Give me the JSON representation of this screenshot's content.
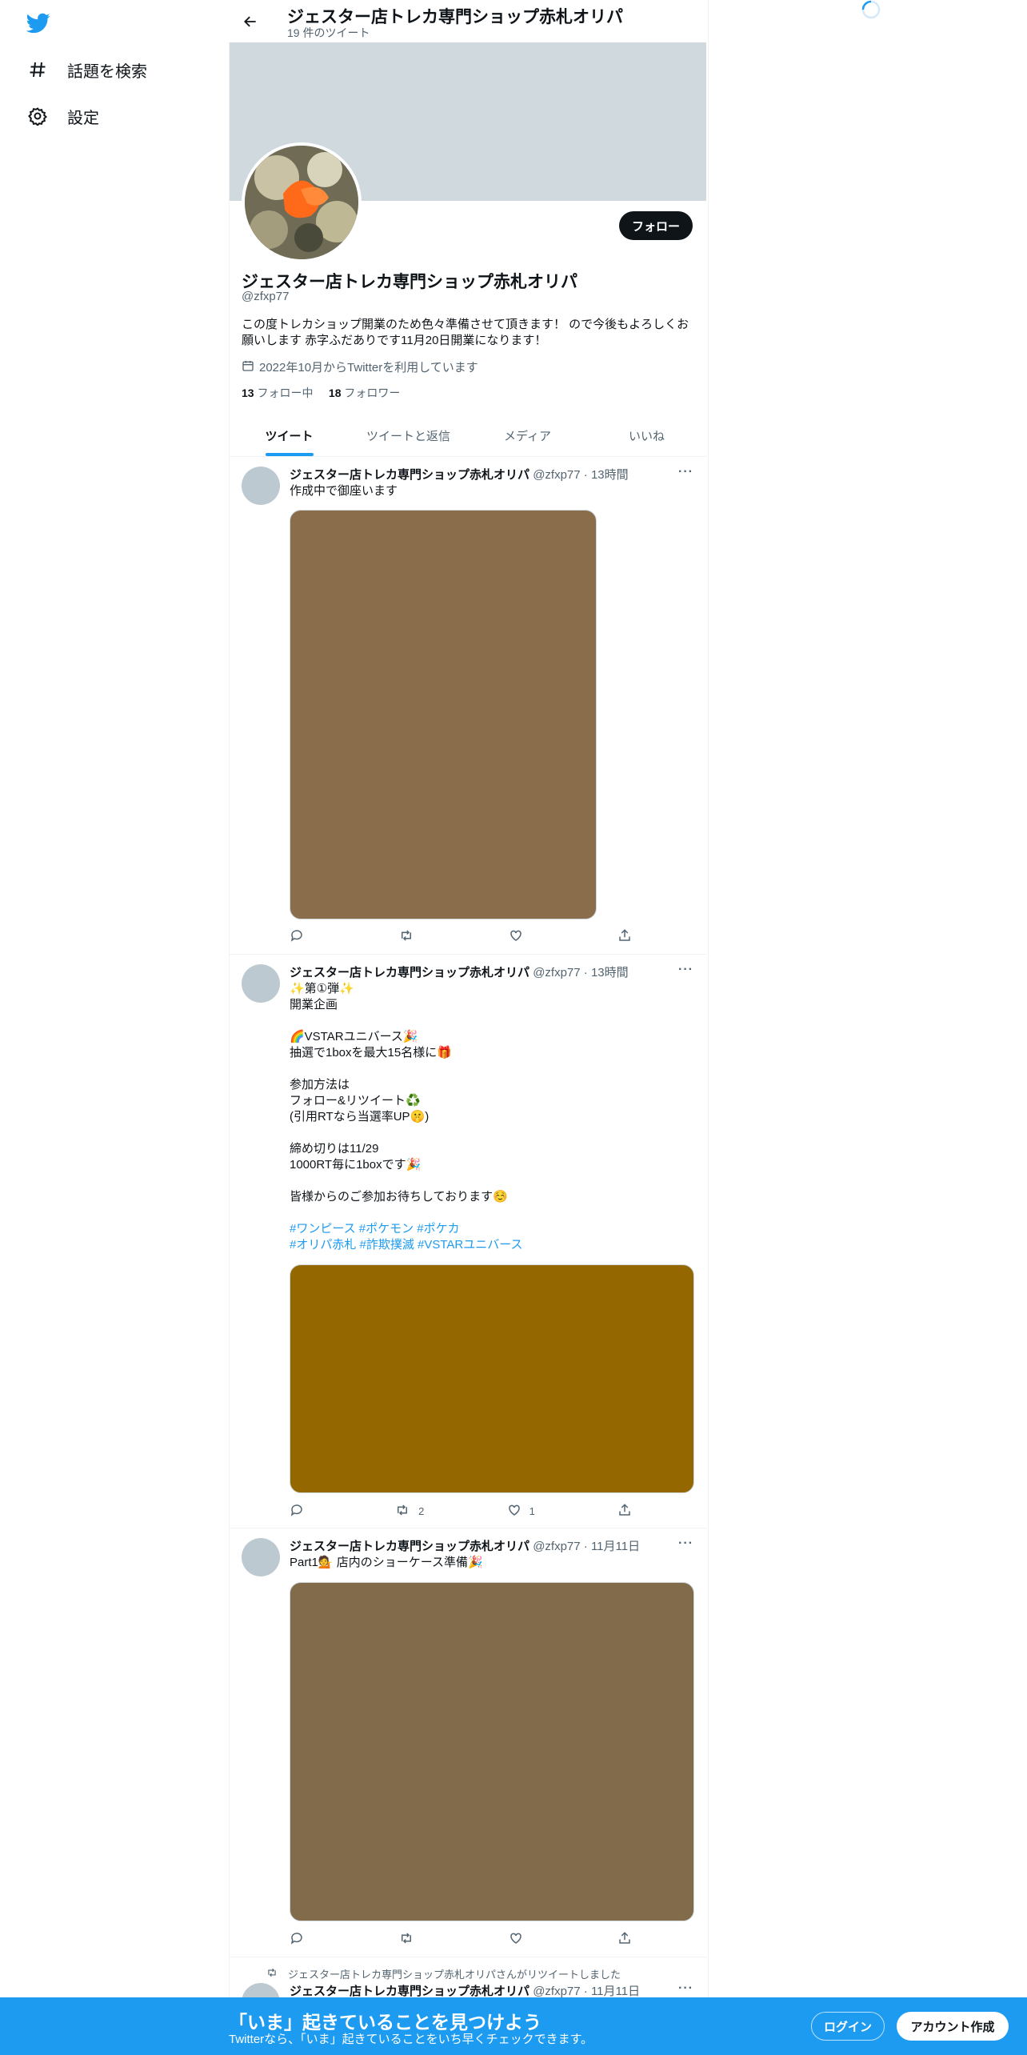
{
  "nav": {
    "items": [
      {
        "label": "話題を検索",
        "icon": "hashtag-icon"
      },
      {
        "label": "設定",
        "icon": "gear-icon"
      }
    ]
  },
  "header": {
    "title": "ジェスター店トレカ専門ショップ赤札オリパ",
    "tweet_count": "19 件のツイート"
  },
  "profile": {
    "name": "ジェスター店トレカ専門ショップ赤札オリパ",
    "handle": "@zfxp77",
    "bio": "この度トレカショップ開業のため色々準備させて頂きます！ ので今後もよろしくお願いします 赤字ふだありです11月20日開業になります！",
    "joined": "2022年10月からTwitterを利用しています",
    "following_count": "13",
    "following_label": "フォロー中",
    "followers_count": "18",
    "followers_label": "フォロワー",
    "follow_button": "フォロー"
  },
  "tabs": [
    "ツイート",
    "ツイートと返信",
    "メディア",
    "いいね"
  ],
  "tweets": [
    {
      "name": "ジェスター店トレカ専門ショップ赤札オリパ",
      "meta": "@zfxp77 · 13時間",
      "text": "作成中で御座います",
      "media_color": "#8a6d4b",
      "reply": "",
      "retweet": "",
      "like": ""
    },
    {
      "name": "ジェスター店トレカ専門ショップ赤札オリパ",
      "meta": "@zfxp77 · 13時間",
      "text": "✨第①弾✨\n開業企画\n\n🌈VSTARユニバース🎉\n抽選で1boxを最大15名様に🎁\n\n参加方法は\nフォロー&リツイート♻️\n(引用RTなら当選率UP🤫)\n\n締め切りは11/29\n1000RT毎に1boxです🎉\n\n皆様からのご参加お待ちしております☺️",
      "hashtags_line1": "#ワンピース #ポケモン #ポケカ",
      "hashtags_line2": "#オリパ赤札 #詐欺撲滅 #VSTARユニバース",
      "media_color": "#946700",
      "reply": "",
      "retweet": "2",
      "like": "1"
    },
    {
      "name": "ジェスター店トレカ専門ショップ赤札オリパ",
      "meta": "@zfxp77 · 11月11日",
      "text": "Part1💁 店内のショーケース準備🎉",
      "media_color": "#816b4b",
      "reply": "",
      "retweet": "",
      "like": ""
    },
    {
      "retweet_note": "ジェスター店トレカ専門ショップ赤札オリパさんがリツイートしました",
      "name": "ジェスター店トレカ専門ショップ赤札オリパ",
      "meta": "@zfxp77 · 11月11日"
    }
  ],
  "bottom_bar": {
    "title": "「いま」起きていることを見つけよう",
    "subtitle": "Twitterなら、「いま」起きていることをいち早くチェックできます。",
    "login": "ログイン",
    "signup": "アカウント作成"
  },
  "colors": {
    "accent": "#1d9bf0",
    "banner": "#cfd9de"
  }
}
